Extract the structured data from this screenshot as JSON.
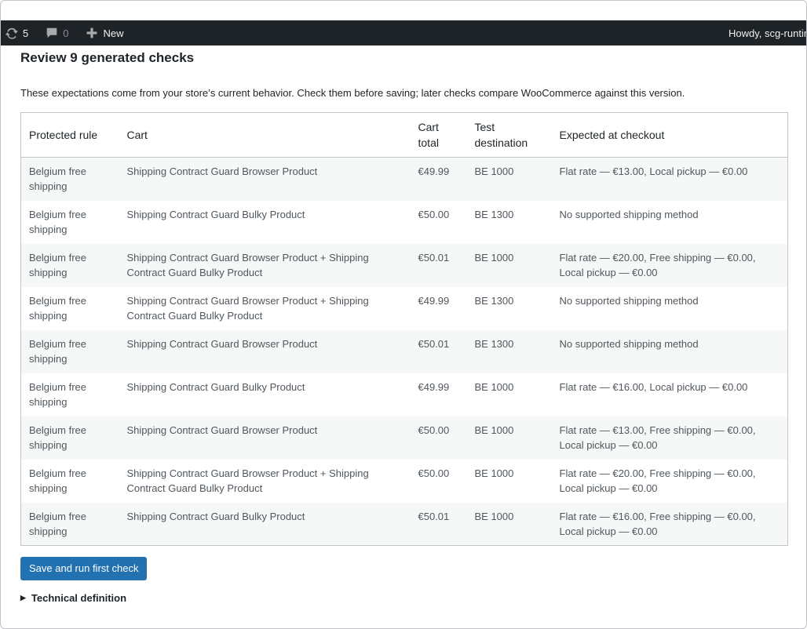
{
  "admin_bar": {
    "updates_count": "5",
    "comments_count": "0",
    "new_label": "New",
    "howdy": "Howdy, scg-runtin"
  },
  "page": {
    "title": "Review 9 generated checks",
    "description": "These expectations come from your store’s current behavior. Check them before saving; later checks compare WooCommerce against this version."
  },
  "table": {
    "headers": {
      "rule": "Protected rule",
      "cart": "Cart",
      "total": "Cart total",
      "destination": "Test destination",
      "expected": "Expected at checkout"
    },
    "rows": [
      {
        "rule": "Belgium free shipping",
        "cart": "Shipping Contract Guard Browser Product",
        "total": "€49.99",
        "destination": "BE 1000",
        "expected": "Flat rate — €13.00, Local pickup — €0.00"
      },
      {
        "rule": "Belgium free shipping",
        "cart": "Shipping Contract Guard Bulky Product",
        "total": "€50.00",
        "destination": "BE 1300",
        "expected": "No supported shipping method"
      },
      {
        "rule": "Belgium free shipping",
        "cart": "Shipping Contract Guard Browser Product + Shipping Contract Guard Bulky Product",
        "total": "€50.01",
        "destination": "BE 1000",
        "expected": "Flat rate — €20.00, Free shipping — €0.00, Local pickup — €0.00"
      },
      {
        "rule": "Belgium free shipping",
        "cart": "Shipping Contract Guard Browser Product + Shipping Contract Guard Bulky Product",
        "total": "€49.99",
        "destination": "BE 1300",
        "expected": "No supported shipping method"
      },
      {
        "rule": "Belgium free shipping",
        "cart": "Shipping Contract Guard Browser Product",
        "total": "€50.01",
        "destination": "BE 1300",
        "expected": "No supported shipping method"
      },
      {
        "rule": "Belgium free shipping",
        "cart": "Shipping Contract Guard Bulky Product",
        "total": "€49.99",
        "destination": "BE 1000",
        "expected": "Flat rate — €16.00, Local pickup — €0.00"
      },
      {
        "rule": "Belgium free shipping",
        "cart": "Shipping Contract Guard Browser Product",
        "total": "€50.00",
        "destination": "BE 1000",
        "expected": "Flat rate — €13.00, Free shipping — €0.00, Local pickup — €0.00"
      },
      {
        "rule": "Belgium free shipping",
        "cart": "Shipping Contract Guard Browser Product + Shipping Contract Guard Bulky Product",
        "total": "€50.00",
        "destination": "BE 1000",
        "expected": "Flat rate — €20.00, Free shipping — €0.00, Local pickup — €0.00"
      },
      {
        "rule": "Belgium free shipping",
        "cart": "Shipping Contract Guard Bulky Product",
        "total": "€50.01",
        "destination": "BE 1000",
        "expected": "Flat rate — €16.00, Free shipping — €0.00, Local pickup — €0.00"
      }
    ]
  },
  "actions": {
    "save_label": "Save and run first check",
    "details_label": "Technical definition"
  }
}
